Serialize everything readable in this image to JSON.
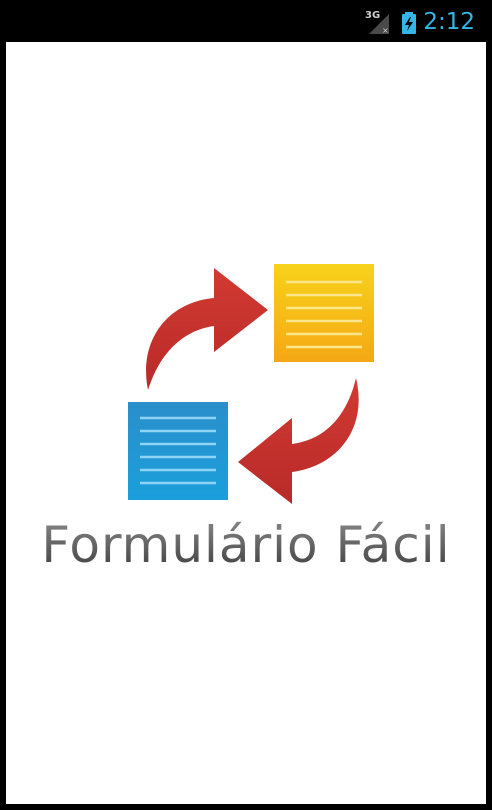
{
  "status_bar": {
    "network_label": "3G",
    "time": "2:12",
    "clock_color": "#33b5e5",
    "icons": [
      "signal-icon",
      "battery-charging-icon"
    ]
  },
  "splash": {
    "app_name": "Formulário Fácil",
    "colors": {
      "arrow": "#c62e2c",
      "doc_yellow": "#f5c518",
      "doc_blue": "#1a9bd7",
      "background": "#ffffff"
    }
  }
}
